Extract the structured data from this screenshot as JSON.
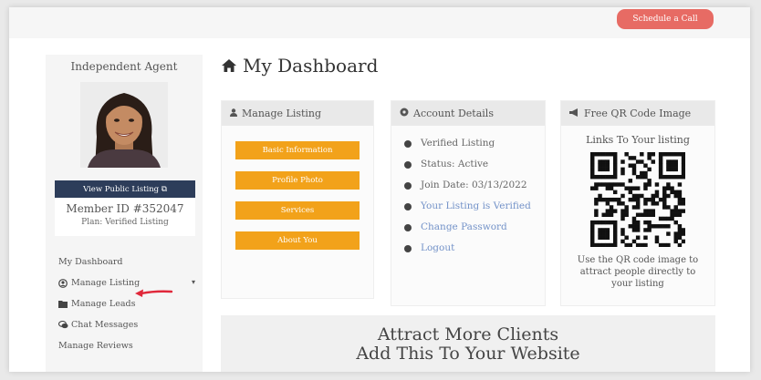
{
  "header": {
    "schedule_label": "Schedule a Call"
  },
  "sidebar": {
    "agent_title": "Independent Agent",
    "view_listing_label": "View Public Listing ⧉",
    "member_id": "Member ID #352047",
    "plan": "Plan: Verified Listing",
    "nav": [
      {
        "label": "My Dashboard",
        "icon": "none"
      },
      {
        "label": "Manage Listing",
        "icon": "user-circle-icon"
      },
      {
        "label": "Manage Leads",
        "icon": "folder-icon"
      },
      {
        "label": "Chat Messages",
        "icon": "chat-icon"
      },
      {
        "label": "Manage Reviews",
        "icon": "none"
      }
    ]
  },
  "main": {
    "title": "My Dashboard",
    "manage_listing": {
      "heading": "Manage Listing",
      "buttons": [
        "Basic Information",
        "Profile Photo",
        "Services",
        "About You"
      ]
    },
    "account_details": {
      "heading": "Account Details",
      "items": [
        {
          "label": "Verified Listing",
          "link": false
        },
        {
          "label": "Status: Active",
          "link": false
        },
        {
          "label": "Join Date: 03/13/2022",
          "link": false
        },
        {
          "label": "Your Listing is Verified",
          "link": true
        },
        {
          "label": "Change Password",
          "link": true
        },
        {
          "label": "Logout",
          "link": true
        }
      ]
    },
    "qr": {
      "heading": "Free QR Code Image",
      "top_text": "Links To Your listing",
      "bottom_text": "Use the QR code image to attract people directly to your listing"
    },
    "attract": {
      "line1": "Attract More Clients",
      "line2": "Add This To Your Website"
    }
  },
  "colors": {
    "accent_orange": "#f2a21a",
    "schedule_red": "#e76b64",
    "navy": "#2d3d5a",
    "link_blue": "#7392c8",
    "annotation_arrow": "#e0283a"
  }
}
